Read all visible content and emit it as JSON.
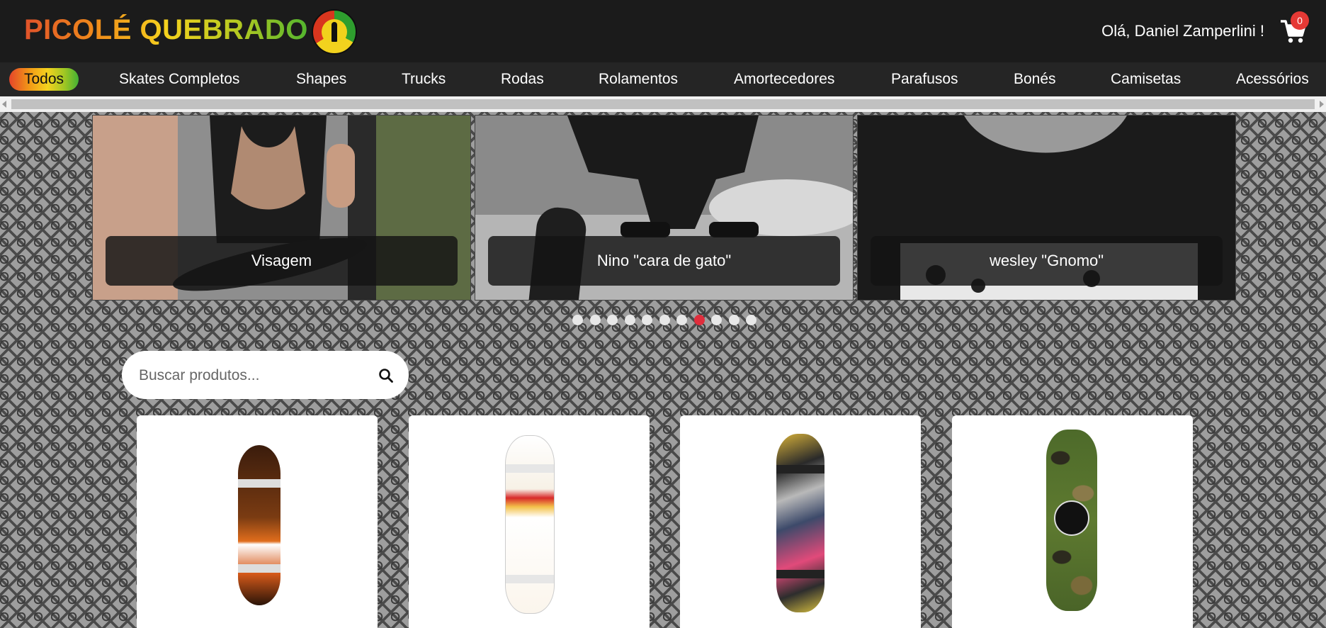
{
  "header": {
    "brand": "PICOLÉ QUEBRADO",
    "greeting": "Olá, Daniel Zamperlini !",
    "cart_count": "0",
    "brand_gradient": [
      "#e0522a",
      "#f5d21e",
      "#52b52e"
    ]
  },
  "nav": {
    "items": [
      {
        "label": "Todos",
        "active": true
      },
      {
        "label": "Skates Completos"
      },
      {
        "label": "Shapes"
      },
      {
        "label": "Trucks"
      },
      {
        "label": "Rodas"
      },
      {
        "label": "Rolamentos"
      },
      {
        "label": "Amortecedores"
      },
      {
        "label": "Parafusos"
      },
      {
        "label": "Bonés"
      },
      {
        "label": "Camisetas"
      },
      {
        "label": "Acessórios"
      }
    ]
  },
  "carousel": {
    "slides": [
      {
        "caption": "Visagem"
      },
      {
        "caption": "Nino \"cara de gato\""
      },
      {
        "caption": "wesley \"Gnomo\""
      }
    ],
    "dot_count": 11,
    "active_dot": 7,
    "active_color": "#e02d3c"
  },
  "search": {
    "placeholder": "Buscar produtos...",
    "value": ""
  },
  "products": [
    {
      "image": "orange-cbgang-skateboard"
    },
    {
      "image": "white-cbgang-beer-label-skateboard"
    },
    {
      "image": "colorful-collage-skateboard"
    },
    {
      "image": "green-camo-skateboard"
    }
  ]
}
